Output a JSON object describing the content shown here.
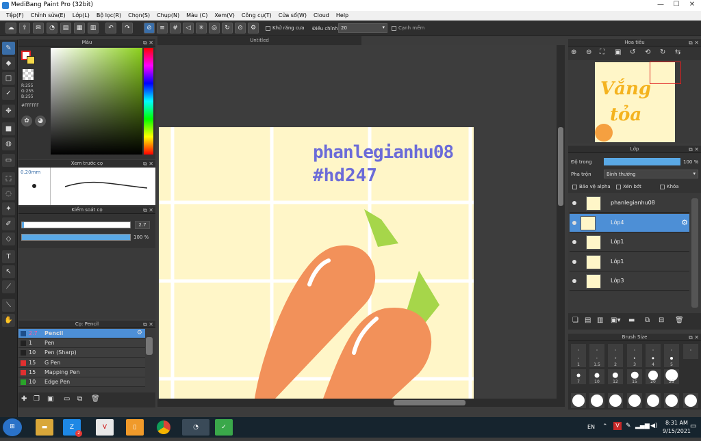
{
  "window": {
    "title": "MediBang Paint Pro (32bit)",
    "minimize": "—",
    "maximize": "☐",
    "close": "✕"
  },
  "menu": [
    "Tệp(F)",
    "Chỉnh sửa(E)",
    "Lớp(L)",
    "Bộ lọc(R)",
    "Chọn(S)",
    "Chụp(N)",
    "Màu (C)",
    "Xem(V)",
    "Công cụ(T)",
    "Cửa sổ(W)",
    "Cloud",
    "Help"
  ],
  "toolbar": {
    "antialias_label": "Khử răng cưa",
    "adjust_label": "Điều chỉnh",
    "adjust_value": "20",
    "edge_label": "Cạnh mềm"
  },
  "color_panel": {
    "title": "Màu",
    "r": "R:255",
    "g": "G:255",
    "b": "B:255",
    "hex": "#FFFFFF"
  },
  "brush_preview": {
    "title": "Xem trước cọ",
    "size": "0.20mm"
  },
  "brush_control": {
    "title": "Kiểm soát cọ",
    "size_value": "2.7",
    "opacity_value": "100 %",
    "size_fraction": 0.02,
    "opacity_fraction": 1.0
  },
  "brush_list": {
    "title": "Cọ: Pencil",
    "items": [
      {
        "size": "2.7",
        "name": "Pencil",
        "color": "#1e4f8a",
        "active": true
      },
      {
        "size": "1",
        "name": "Pen",
        "color": "#222222"
      },
      {
        "size": "10",
        "name": "Pen (Sharp)",
        "color": "#222222"
      },
      {
        "size": "15",
        "name": "G Pen",
        "color": "#e03030"
      },
      {
        "size": "15",
        "name": "Mapping Pen",
        "color": "#e03030"
      },
      {
        "size": "10",
        "name": "Edge Pen",
        "color": "#2aa52a"
      }
    ]
  },
  "canvas": {
    "tab_title": "Untitled",
    "watermark_line1": "phanlegianhu08",
    "watermark_line2": "#hd247"
  },
  "navigator": {
    "title": "Hoa tiêu",
    "preview_text_1": "Vắng",
    "preview_text_2": "tỏa"
  },
  "layer_panel": {
    "title": "Lớp",
    "opacity_label": "Độ trong",
    "opacity_value": "100 %",
    "opacity_fraction": 1.0,
    "blend_label": "Pha trộn",
    "blend_value": "Bình thường",
    "protect_alpha": "Bảo vệ alpha",
    "clipping": "Xén bớt",
    "lock": "Khóa",
    "layers": [
      {
        "name": "phanlegianhu08",
        "active": false
      },
      {
        "name": "Lớp4",
        "active": true
      },
      {
        "name": "Lớp1",
        "active": false
      },
      {
        "name": "Lớp1",
        "active": false
      },
      {
        "name": "Lớp3",
        "active": false
      }
    ]
  },
  "brush_size_panel": {
    "title": "Brush Size",
    "row1": [
      "1",
      "1.5",
      "2",
      "3",
      "4",
      "5"
    ],
    "row2": [
      "7",
      "10",
      "12",
      "15",
      "20",
      "25"
    ]
  },
  "taskbar": {
    "lang": "EN",
    "time": "8:31 AM",
    "date": "9/15/2021",
    "zalo_badge": "2"
  }
}
